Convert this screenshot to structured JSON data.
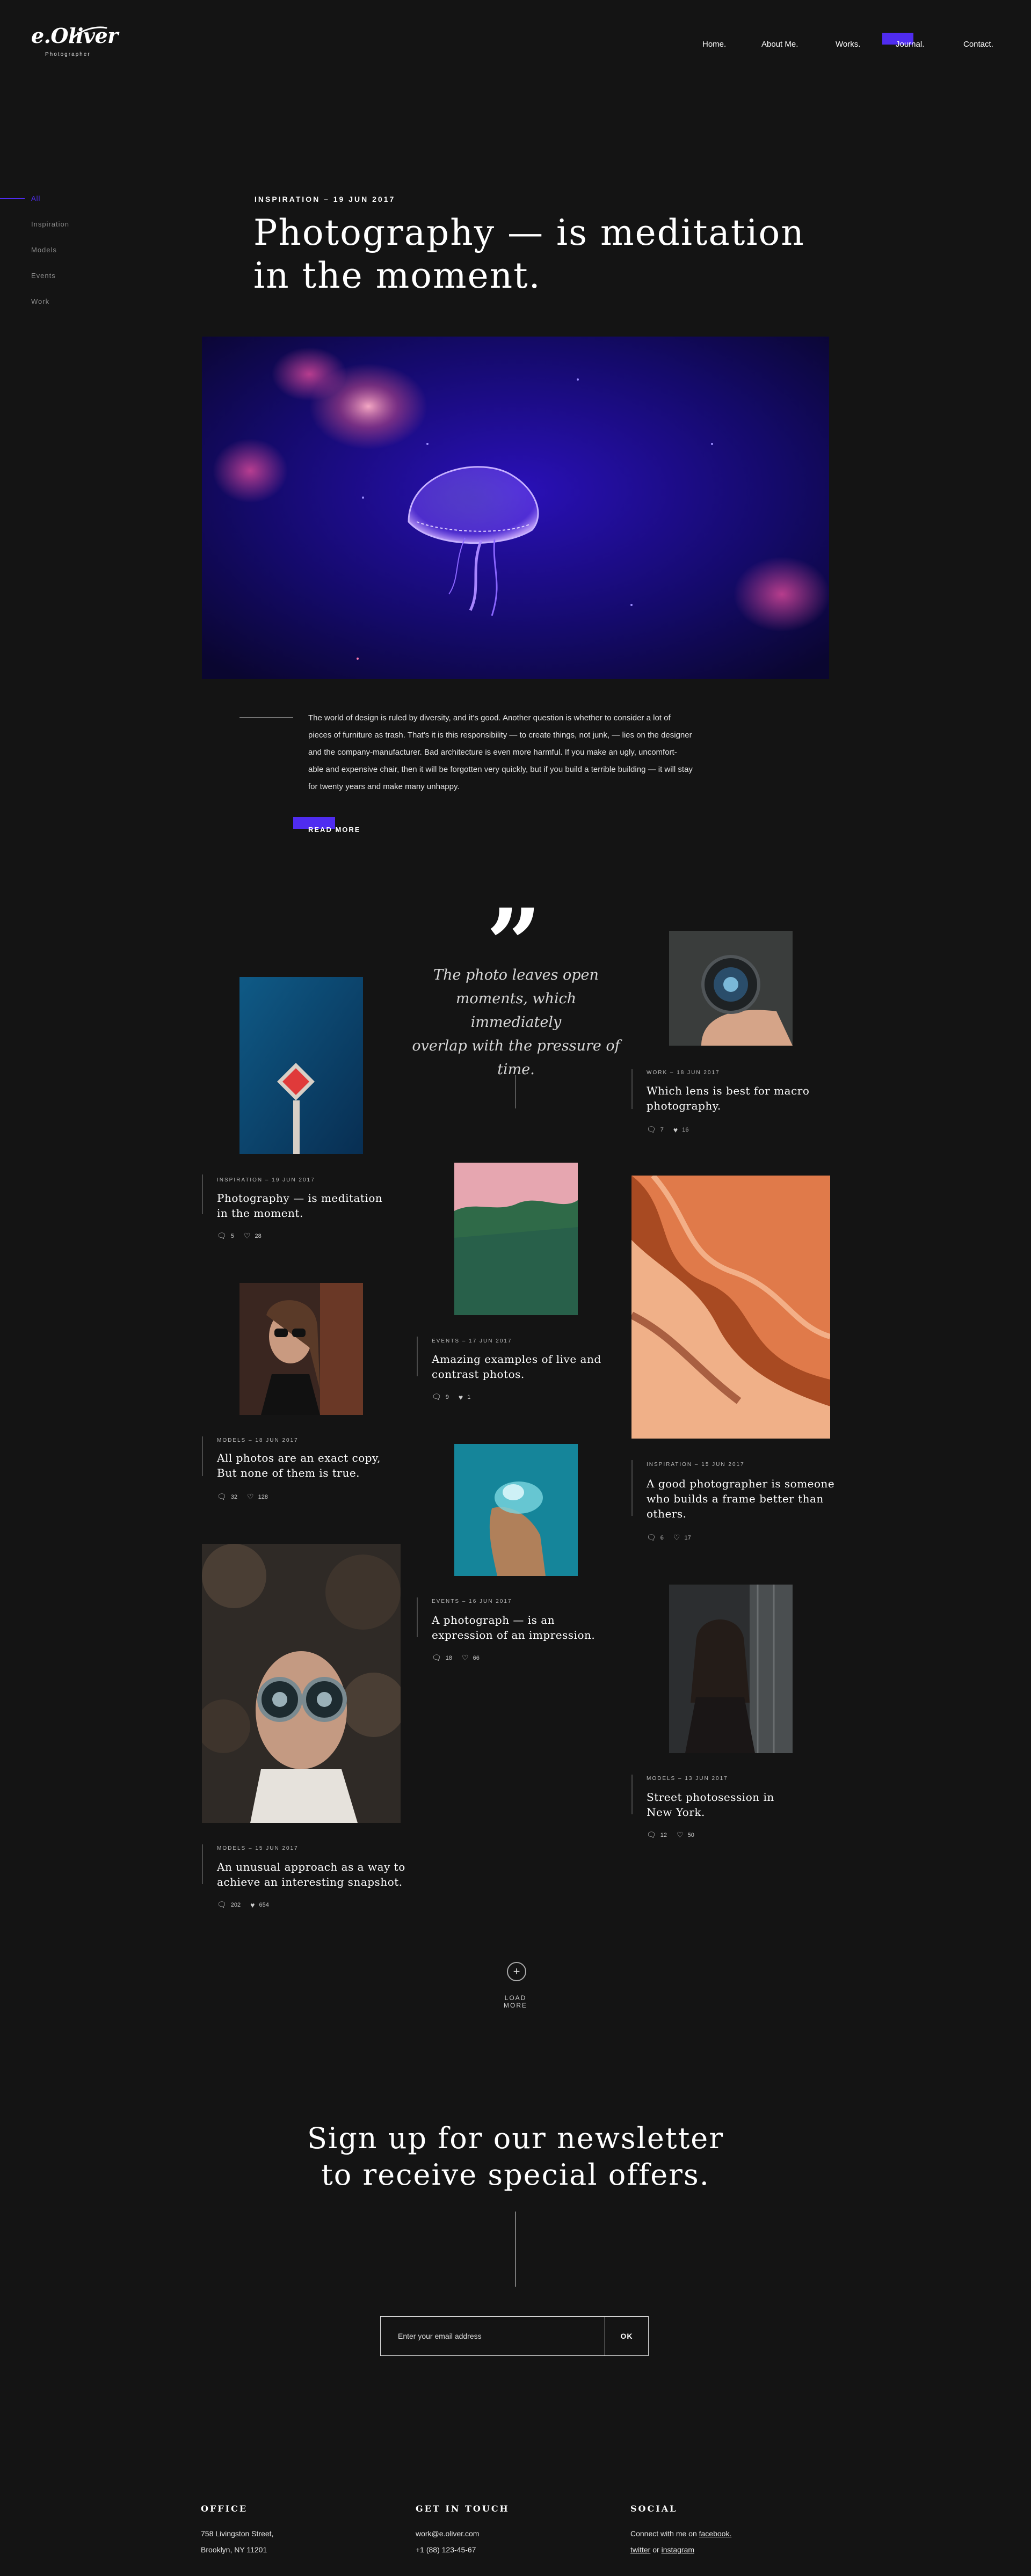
{
  "brand": {
    "name": "e.Oliver",
    "tagline": "Photographer"
  },
  "nav": {
    "items": [
      "Home.",
      "About Me.",
      "Works.",
      "Journal.",
      "Contact."
    ]
  },
  "sidebar": {
    "items": [
      "All",
      "Inspiration",
      "Models",
      "Events",
      "Work"
    ],
    "active": "All"
  },
  "hero": {
    "meta": "INSPIRATION – 19 JUN 2017",
    "title_line1": "Photography — is meditation",
    "title_line2": "in the moment.",
    "intro_lines": [
      "The world of design is ruled by diversity, and it's good. Another question is whether to consider a lot of",
      "pieces of furniture as trash. That's it is this responsibility — to create things, not junk, — lies on the designer",
      "and the company-manufacturer. Bad architecture is even more harmful. If you make an ugly, uncomfort-",
      "able and expensive chair, then it will be forgotten very quickly, but if you build a terrible building — it will stay",
      "for twenty years and make many unhappy."
    ],
    "read_more": "READ MORE"
  },
  "quote": {
    "mark": "”",
    "lines": [
      "The photo leaves open",
      "moments, which immediately",
      "overlap with the pressure of",
      "time."
    ]
  },
  "posts": [
    {
      "meta": "INSPIRATION – 19 JUN 2017",
      "title1": "Photography — is meditation",
      "title2": "in the moment.",
      "comments": "5",
      "likes": "28"
    },
    {
      "meta": "MODELS – 18 JUN 2017",
      "title1": "All photos are an exact copy,",
      "title2": "But none of them is true.",
      "comments": "32",
      "likes": "128"
    },
    {
      "meta": "MODELS – 15 JUN 2017",
      "title1": "An unusual approach as a way to",
      "title2": "achieve an interesting snapshot.",
      "comments": "202",
      "likes": "654"
    },
    {
      "meta": "EVENTS – 17 JUN 2017",
      "title1": "Amazing examples of live and",
      "title2": "contrast photos.",
      "comments": "9",
      "likes": "1"
    },
    {
      "meta": "EVENTS – 16 JUN 2017",
      "title1": "A photograph — is an",
      "title2": "expression of an impression.",
      "comments": "18",
      "likes": "66"
    },
    {
      "meta": "WORK – 18 JUN 2017",
      "title1": "Which lens is best for macro",
      "title2": "photography.",
      "comments": "7",
      "likes": "16"
    },
    {
      "meta": "INSPIRATION – 15 JUN 2017",
      "title1": "A good photographer is someone",
      "title2": "who builds a frame better than",
      "title3": "others.",
      "comments": "6",
      "likes": "17"
    },
    {
      "meta": "MODELS – 13 JUN 2017",
      "title1": "Street photosession in",
      "title2": "New York.",
      "comments": "12",
      "likes": "50"
    }
  ],
  "load_more": {
    "icon": "+",
    "label": "LOAD MORE"
  },
  "newsletter": {
    "line1": "Sign up for our newsletter",
    "line2": "to receive special offers.",
    "placeholder": "Enter your email address",
    "submit": "OK"
  },
  "footer": {
    "office": {
      "heading": "OFFICE",
      "line1": "758 Livingston Street,",
      "line2": "Brooklyn, NY 11201"
    },
    "contact": {
      "heading": "GET IN TOUCH",
      "email": "work@e.oliver.com",
      "phone": "+1 (88) 123-45-67"
    },
    "social": {
      "heading": "SOCIAL",
      "prefix": "Connect with me on",
      "facebook": "facebook.",
      "twitter": "twitter",
      "or": "or",
      "instagram": "instagram"
    }
  },
  "icons": {
    "comment": "comment-icon",
    "like": "heart-icon",
    "plus": "plus-icon"
  },
  "colors": {
    "background": "#141414",
    "accent": "#4f2cf0",
    "text": "#ffffff"
  }
}
